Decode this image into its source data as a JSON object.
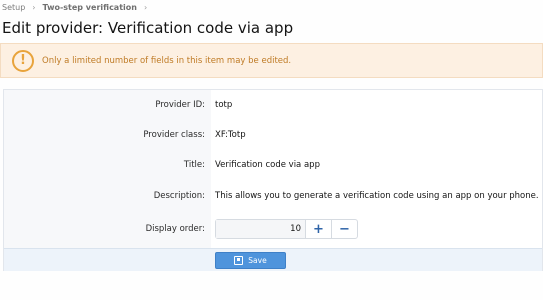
{
  "breadcrumb": {
    "items": [
      "Setup",
      "Two-step verification"
    ],
    "separator": "›"
  },
  "page": {
    "title": "Edit provider: Verification code via app"
  },
  "notice": {
    "icon": "exclamation-circle-icon",
    "text": "Only a limited number of fields in this item may be edited."
  },
  "form": {
    "provider_id": {
      "label": "Provider ID:",
      "value": "totp"
    },
    "provider_class": {
      "label": "Provider class:",
      "value": "XF:Totp"
    },
    "title": {
      "label": "Title:",
      "value": "Verification code via app"
    },
    "description": {
      "label": "Description:",
      "value": "This allows you to generate a verification code using an app on your phone."
    },
    "display_order": {
      "label": "Display order:",
      "value": "10",
      "increment": "+",
      "decrement": "−"
    }
  },
  "actions": {
    "save_label": "Save",
    "save_icon": "save-icon"
  },
  "colors": {
    "accent": "#4f94dc",
    "notice_bg": "#fdf0e2",
    "notice_text": "#bf7b26"
  }
}
